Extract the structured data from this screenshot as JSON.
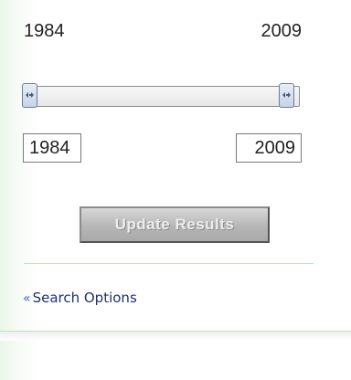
{
  "year_range": {
    "min_label": "1984",
    "max_label": "2009",
    "slider": {
      "min": 1984,
      "max": 2009,
      "from": 1984,
      "to": 2009
    },
    "from_value": "1984",
    "to_value": "2009"
  },
  "actions": {
    "update_label": "Update Results"
  },
  "links": {
    "search_options_prefix": "«",
    "search_options": "Search Options"
  }
}
